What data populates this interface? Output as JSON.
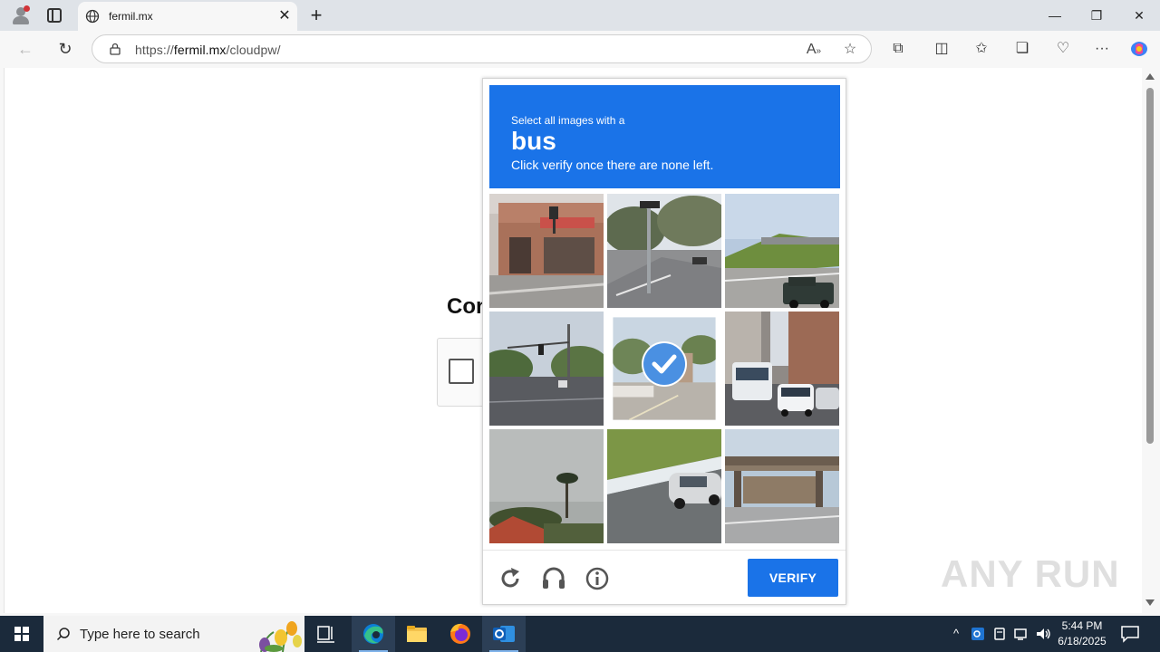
{
  "browser": {
    "tab_title": "fermil.mx",
    "url_prefix": "https://",
    "url_host": "fermil.mx",
    "url_path": "/cloudpw/",
    "window_controls": {
      "minimize": "—",
      "restore": "❐",
      "close": "✕"
    },
    "tab_close": "✕",
    "new_tab": "+"
  },
  "page": {
    "heading_partial": "Con"
  },
  "captcha": {
    "prompt": "Select all images with a",
    "keyword": "bus",
    "instruction": "Click verify once there are none left.",
    "verify_label": "VERIFY",
    "accent_color": "#1a73e8",
    "tiles": [
      {
        "scene": "storefront-corner",
        "selected": false
      },
      {
        "scene": "street-intersection",
        "selected": false
      },
      {
        "scene": "highway-overpass",
        "selected": false
      },
      {
        "scene": "road-traffic-lights",
        "selected": false
      },
      {
        "scene": "street-sidewalk",
        "selected": true
      },
      {
        "scene": "city-bus-traffic",
        "selected": false
      },
      {
        "scene": "palm-trees-sky",
        "selected": false
      },
      {
        "scene": "car-on-road",
        "selected": false
      },
      {
        "scene": "railway-bridge",
        "selected": false
      }
    ]
  },
  "watermark": "ANY RUN",
  "taskbar": {
    "search_placeholder": "Type here to search",
    "time": "5:44 PM",
    "date": "6/18/2025"
  }
}
